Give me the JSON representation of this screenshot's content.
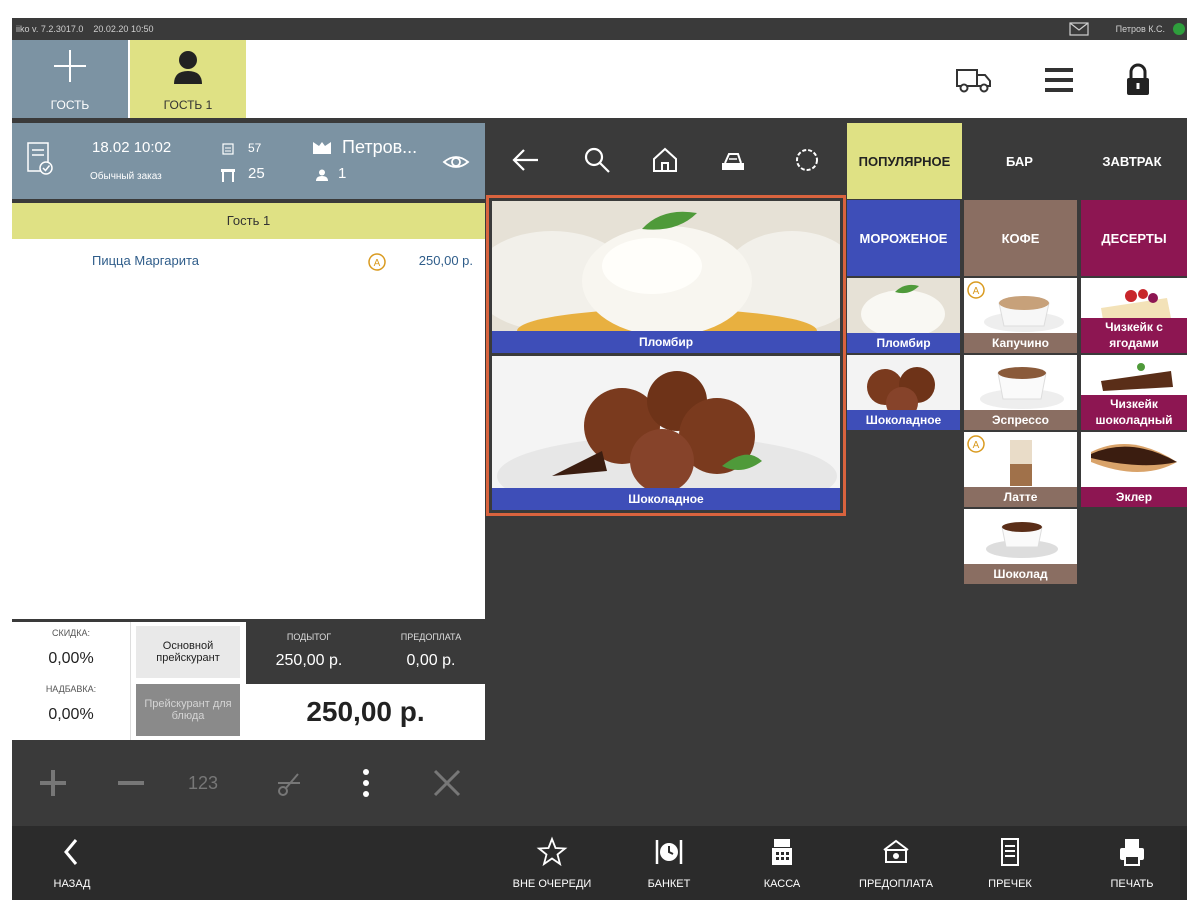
{
  "status_bar": {
    "version": "iiko v. 7.2.3017.0",
    "datetime": "20.02.20 10:50",
    "user": "Петров К.С."
  },
  "top_bar": {
    "add_guest_label": "ГОСТЬ",
    "guest_tab_label": "ГОСТЬ 1"
  },
  "order": {
    "datetime": "18.02 10:02",
    "type": "Обычный заказ",
    "number": "57",
    "table": "25",
    "waiter": "Петров...",
    "guests": "1",
    "guest_title": "Гость 1",
    "items": [
      {
        "name": "Пицца Маргарита",
        "price": "250,00 р."
      }
    ]
  },
  "totals": {
    "discount_label": "СКИДКА:",
    "discount_value": "0,00%",
    "surcharge_label": "НАДБАВКА:",
    "surcharge_value": "0,00%",
    "pricelist_main": "Основной прейскурант",
    "pricelist_dish": "Прейскурант для блюда",
    "subtotal_label": "ПОДЫТОГ",
    "subtotal_value": "250,00 р.",
    "prepay_label": "ПРЕДОПЛАТА",
    "prepay_value": "0,00 р.",
    "total_value": "250,00 р."
  },
  "tools": {
    "numpad_label": "123"
  },
  "categories": {
    "popular": "ПОПУЛЯРНОЕ",
    "bar": "БАР",
    "breakfast": "ЗАВТРАК",
    "icecream": "МОРОЖЕНОЕ",
    "coffee": "КОФЕ",
    "desserts": "ДЕСЕРТЫ"
  },
  "featured": [
    {
      "name": "Пломбир"
    },
    {
      "name": "Шоколадное"
    }
  ],
  "products": {
    "icecream": [
      "Пломбир",
      "Шоколадное"
    ],
    "coffee": [
      "Капучино",
      "Эспрессо",
      "Латте",
      "Шоколад"
    ],
    "desserts": [
      "Чизкейк с ягодами",
      "Чизкейк шоколадный",
      "Эклер"
    ]
  },
  "bottom_bar": {
    "back": "НАЗАД",
    "priority": "ВНЕ ОЧЕРЕДИ",
    "banquet": "БАНКЕТ",
    "cashier": "КАССА",
    "prepayment": "ПРЕДОПЛАТА",
    "precheck": "ПРЕЧЕК",
    "print": "ПЕЧАТЬ"
  },
  "colors": {
    "topbar_slate": "#7c93a3",
    "guest_yellow": "#dfe184",
    "label_blue": "#3e4eb8",
    "coffee_brown": "#8a6e62",
    "dessert_purple": "#8d1652",
    "highlight_orange": "#d9633e",
    "status_green": "#2e9e3c"
  }
}
